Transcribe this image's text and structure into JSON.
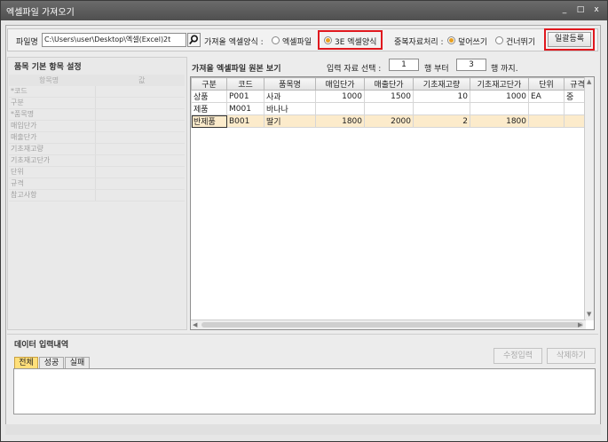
{
  "window": {
    "title": "엑셀파일 가져오기",
    "controls": [
      "_",
      "□",
      "x"
    ]
  },
  "toolbar": {
    "file_label": "파일명",
    "file_path": "C:\\Users\\user\\Desktop\\엑셀(Excel)2t",
    "format_label": "가져올 엑셀양식 :",
    "format_options": [
      {
        "label": "엑셀파일",
        "selected": false
      },
      {
        "label": "3E 엑셀양식",
        "selected": true
      }
    ],
    "dup_label": "중복자료처리 :",
    "dup_options": [
      {
        "label": "덮어쓰기",
        "selected": true
      },
      {
        "label": "건너뛰기",
        "selected": false
      }
    ],
    "bulk_register_label": "일괄등록"
  },
  "left_panel": {
    "title": "품목 기본 항목 설정",
    "columns": [
      "항목명",
      "값"
    ],
    "rows": [
      "*코드",
      "구분",
      "*품목명",
      "매입단가",
      "매출단가",
      "기초재고량",
      "기초재고단가",
      "단위",
      "규격",
      "참고사항"
    ]
  },
  "right_panel": {
    "title": "가져올 엑셀파일 원본 보기",
    "range_label": "입력 자료 선택 :",
    "from_value": "1",
    "from_suffix": "행 부터",
    "to_value": "3",
    "to_suffix": "행 까지."
  },
  "grid": {
    "columns": [
      "구분",
      "코드",
      "품목명",
      "매입단가",
      "매출단가",
      "기초재고량",
      "기초재고단가",
      "단위",
      "규격"
    ],
    "rows": [
      [
        "상품",
        "P001",
        "사과",
        "1000",
        "1500",
        "10",
        "1000",
        "EA",
        "중"
      ],
      [
        "제품",
        "M001",
        "바나나",
        "",
        "",
        "",
        "",
        "",
        ""
      ],
      [
        "반제품",
        "B001",
        "딸기",
        "1800",
        "2000",
        "2",
        "1800",
        "",
        ""
      ]
    ],
    "selected_row": 2
  },
  "bottom_panel": {
    "title": "데이터 입력내역",
    "tabs": [
      "전체",
      "성공",
      "실패"
    ],
    "active_tab": 0,
    "edit_button": "수정입력",
    "delete_button": "삭제하기"
  },
  "colors": {
    "highlight_box": "#e0181e",
    "selected_row": "#fcebcb",
    "active_tab": "#ffdf7a",
    "radio_on": "#e8a020"
  }
}
